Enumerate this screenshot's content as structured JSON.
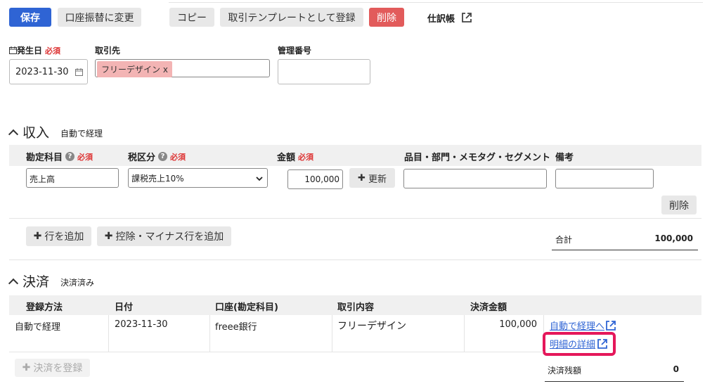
{
  "toolbar": {
    "save_label": "保存",
    "transfer_label": "口座振替に変更",
    "copy_label": "コピー",
    "template_label": "取引テンプレートとして登録",
    "delete_label": "削除",
    "journal_label": "仕訳帳"
  },
  "header_fields": {
    "date_label": "発生日",
    "required": "必須",
    "date_value": "2023-11-30",
    "partner_label": "取引先",
    "partner_tag": "フリーデザイン x",
    "mgmt_label": "管理番号",
    "mgmt_value": ""
  },
  "income": {
    "title": "収入",
    "status": "自動で経理",
    "col_account": "勘定科目",
    "col_tax": "税区分",
    "col_amount": "金額",
    "col_items": "品目・部門・メモタグ・セグメント",
    "col_note": "備考",
    "required": "必須",
    "row_account": "売上高",
    "row_tax": "課税売上10%",
    "row_amount": "100,000",
    "update_label": "更新",
    "row_delete": "削除",
    "add_row": "行を追加",
    "add_deduction": "控除・マイナス行を追加",
    "total_label": "合計",
    "total_value": "100,000"
  },
  "settlement": {
    "title": "決済",
    "status": "決済済み",
    "col_method": "登録方法",
    "col_date": "日付",
    "col_account": "口座(勘定科目)",
    "col_content": "取引内容",
    "col_amount": "決済金額",
    "row_method": "自動で経理",
    "row_date": "2023-11-30",
    "row_account": "freee銀行",
    "row_content": "フリーデザイン",
    "row_amount": "100,000",
    "link_auto": "自動で経理へ",
    "link_detail": "明細の詳細",
    "register_label": "決済を登録",
    "balance_label": "決済残額",
    "balance_value": "0"
  },
  "colors": {
    "primary": "#2f64d4",
    "danger": "#e25b5b",
    "highlight": "#e5175a",
    "tag_bg": "#f3b4b4"
  }
}
